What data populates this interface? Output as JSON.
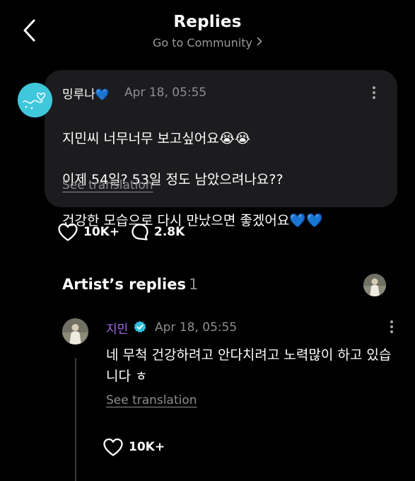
{
  "header": {
    "title": "Replies",
    "community_link": "Go to Community"
  },
  "post": {
    "author": "밍루나",
    "author_emoji": "💙",
    "timestamp": "Apr 18, 05:55",
    "body_lines": [
      "지민씨 너무너무 보고싶어요😭😭",
      "이제 54일? 53일 정도 남았으려나요??",
      "건강한 모습으로 다시 만났으면 좋겠어요💙💙"
    ],
    "see_translation": "See translation",
    "likes": "10K+",
    "comments": "2.8K"
  },
  "artist_replies": {
    "heading": "Artist’s replies",
    "count": "1"
  },
  "reply": {
    "author": "지민",
    "timestamp": "Apr 18, 05:55",
    "body": "네 무척 건강하려고 안다치려고 노력많이 하고 있습니다 ㅎ",
    "see_translation": "See translation",
    "likes": "10K+"
  },
  "colors": {
    "background": "#000000",
    "bubble": "#1c1c1e",
    "muted_text": "#8e8e93",
    "artist_name": "#a46ce8",
    "verified_badge": "#2fc0e0",
    "avatar_main": "#3fc7dc",
    "heart_emoji": "#2f7fe6"
  },
  "icons": {
    "back": "chevron-left-icon",
    "community": "chevron-right-icon",
    "more": "more-vertical-icon",
    "like": "heart-outline-icon",
    "comment": "comment-bubble-icon",
    "verified": "verified-check-icon"
  }
}
